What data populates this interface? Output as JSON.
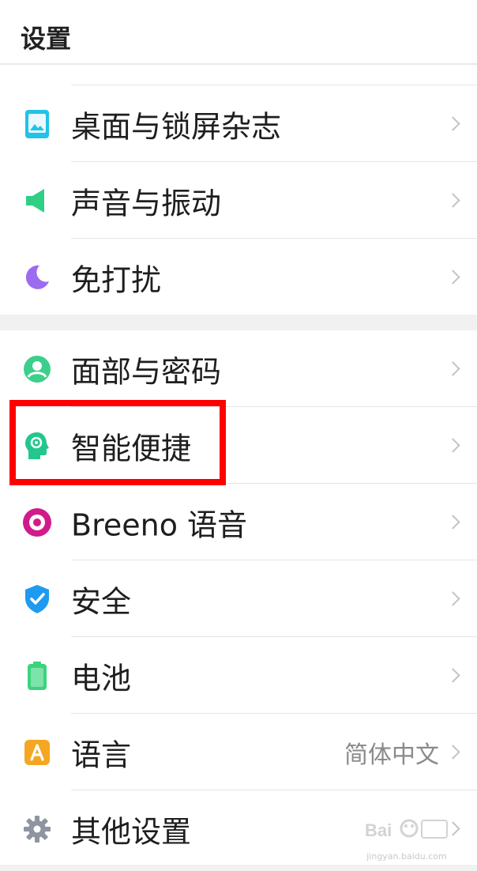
{
  "header": {
    "title": "设置"
  },
  "items": [
    {
      "label": "桌面与锁屏杂志",
      "icon": "wallpaper-icon",
      "value": ""
    },
    {
      "label": "声音与振动",
      "icon": "speaker-icon",
      "value": ""
    },
    {
      "label": "免打扰",
      "icon": "moon-icon",
      "value": ""
    },
    {
      "label": "面部与密码",
      "icon": "face-user-icon",
      "value": ""
    },
    {
      "label": "智能便捷",
      "icon": "smart-head-icon",
      "value": ""
    },
    {
      "label": "Breeno 语音",
      "icon": "breeno-ring-icon",
      "value": ""
    },
    {
      "label": "安全",
      "icon": "shield-icon",
      "value": ""
    },
    {
      "label": "电池",
      "icon": "battery-icon",
      "value": ""
    },
    {
      "label": "语言",
      "icon": "language-a-icon",
      "value": "简体中文"
    },
    {
      "label": "其他设置",
      "icon": "gear-icon",
      "value": ""
    }
  ],
  "watermark": {
    "text": "jingyan.baidu.com"
  },
  "colors": {
    "highlight": "#ff0000",
    "wallpaper": "#21c3e6",
    "sound": "#2fcf84",
    "moon": "#9b6cf0",
    "face": "#3ccf8c",
    "smart": "#23c78d",
    "breeno": "#d11b8a",
    "shield": "#1e9bf0",
    "battery": "#3ad37e",
    "language": "#f5a623",
    "gear": "#8e95a0"
  }
}
